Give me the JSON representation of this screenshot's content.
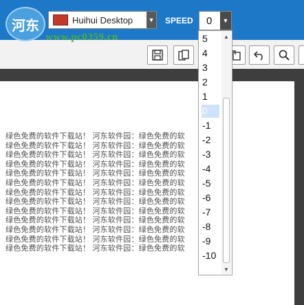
{
  "header": {
    "watermark_logo_text": "河东",
    "watermark_url": "www.pc0359.cn",
    "theme_select": {
      "value": "Huihui Desktop",
      "flag_color": "#c0392b"
    },
    "speed_label": "SPEED",
    "speed_select": {
      "value": "0"
    }
  },
  "toolbar": {
    "icons": [
      "save-icon",
      "copy-pages-icon",
      "export-icon",
      "undo-icon",
      "search-icon"
    ]
  },
  "speed_options": [
    "5",
    "4",
    "3",
    "2",
    "1",
    "0",
    "-1",
    "-2",
    "-3",
    "-4",
    "-5",
    "-6",
    "-7",
    "-8",
    "-9",
    "-10"
  ],
  "speed_selected_index": 5,
  "document": {
    "line_text": "绿色免费的软件下载站！ 河东软件园：绿色免费的软",
    "line_count": 13
  },
  "colors": {
    "topbar": "#1e78c8",
    "selected_option": "#cfe2fb",
    "watermark_green": "#4cae3a"
  }
}
